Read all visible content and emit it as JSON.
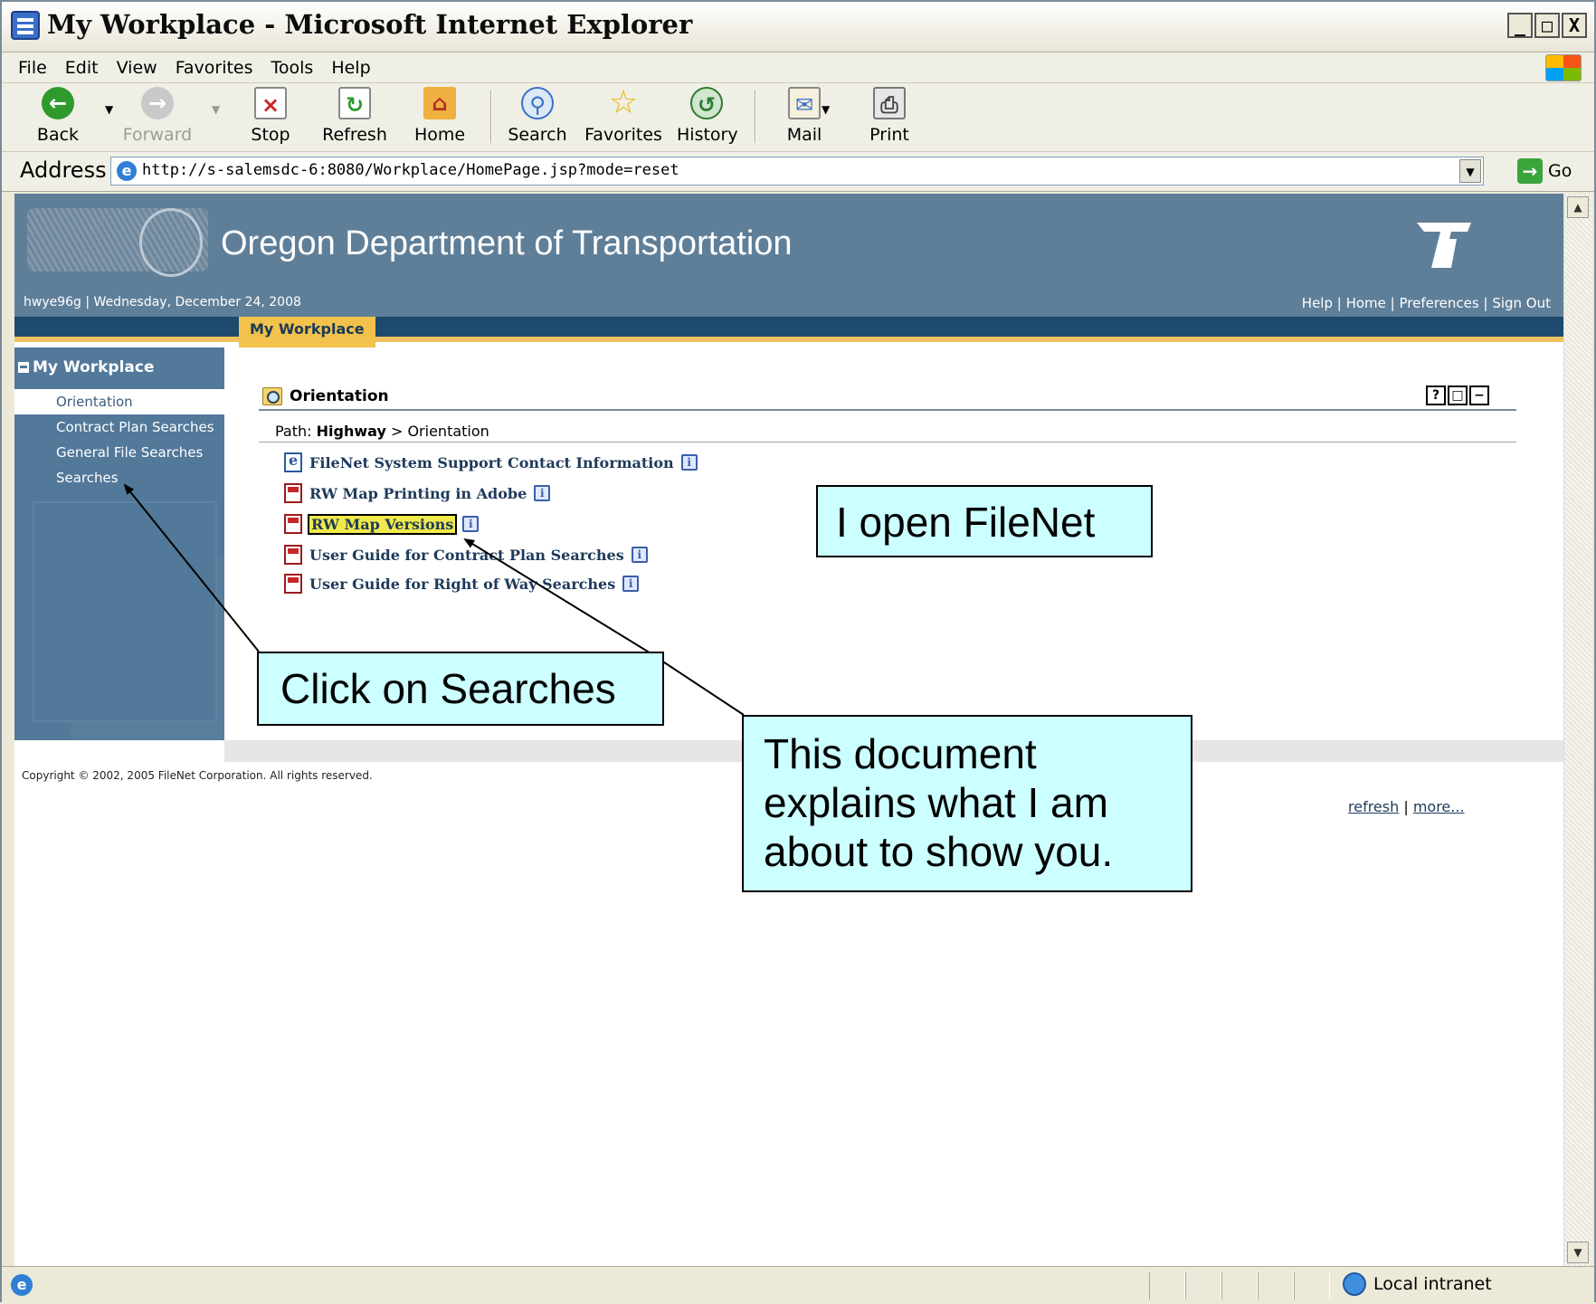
{
  "window": {
    "title": "My Workplace - Microsoft Internet Explorer",
    "controls": [
      "_",
      "□",
      "X"
    ]
  },
  "menu": {
    "items": [
      "File",
      "Edit",
      "View",
      "Favorites",
      "Tools",
      "Help"
    ]
  },
  "toolbar": {
    "back": "Back",
    "forward": "Forward",
    "stop": "Stop",
    "refresh": "Refresh",
    "home": "Home",
    "search": "Search",
    "favorites": "Favorites",
    "history": "History",
    "mail": "Mail",
    "print": "Print"
  },
  "address": {
    "label": "Address",
    "url": "http://s-salemsdc-6:8080/Workplace/HomePage.jsp?mode=reset",
    "go": "Go"
  },
  "header": {
    "title": "Oregon Department of Transportation",
    "user_date": "hwye96g | Wednesday, December 24, 2008",
    "links": [
      "Help",
      "Home",
      "Preferences",
      "Sign Out"
    ]
  },
  "tabs": {
    "active": "My Workplace"
  },
  "sidebar": {
    "heading": "My Workplace",
    "items": [
      {
        "label": "Orientation",
        "active": true
      },
      {
        "label": "Contract Plan Searches",
        "active": false
      },
      {
        "label": "General File Searches",
        "active": false
      },
      {
        "label": "Searches",
        "active": false
      }
    ]
  },
  "portlet": {
    "title": "Orientation",
    "controls": [
      "?",
      "□",
      "−"
    ],
    "path_prefix": "Path:",
    "path_bold": "Highway",
    "path_rest": "> Orientation",
    "documents": [
      {
        "label": "FileNet System Support Contact Information",
        "icon": "web-document-icon"
      },
      {
        "label": "RW Map Printing in Adobe",
        "icon": "pdf-icon"
      },
      {
        "label": "RW Map Versions",
        "icon": "pdf-icon"
      },
      {
        "label": "User Guide for Contract Plan Searches",
        "icon": "pdf-icon"
      },
      {
        "label": "User Guide for Right of Way Searches",
        "icon": "pdf-icon"
      }
    ],
    "footer_refresh": "refresh",
    "footer_sep": "|",
    "footer_more": "more..."
  },
  "copyright": "Copyright © 2002, 2005 FileNet Corporation. All rights reserved.",
  "callouts": {
    "open_filenet": "I open FileNet",
    "click_searches": "Click on Searches",
    "document_explains": "This document explains what I am about to show you."
  },
  "status": {
    "zone": "Local intranet"
  },
  "colors": {
    "header_bg": "#5f7f99",
    "tabbar_bg": "#1e4a6e",
    "tab_active": "#f2c24d",
    "sidebar_bg": "#52789a",
    "callout_bg": "#ccffff",
    "highlight": "#f0ea4a"
  }
}
